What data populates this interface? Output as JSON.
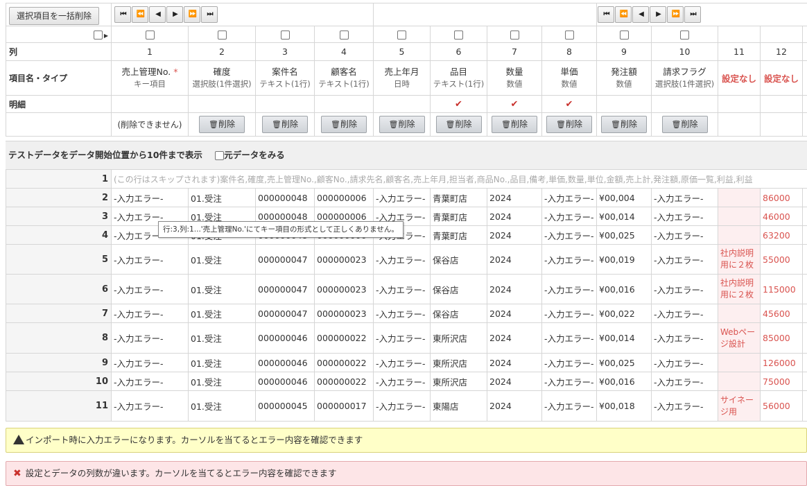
{
  "toolbar": {
    "bulk_delete_label": "選択項目を一括削除",
    "nav_first": "⏮",
    "nav_prev_fast": "⏪",
    "nav_prev": "◀",
    "nav_next": "▶",
    "nav_next_fast": "⏩",
    "nav_last": "⏭"
  },
  "header_rows": {
    "col_label": "列",
    "name_label": "項目名・タイプ",
    "detail_label": "明細",
    "undeletable": "(削除できません)",
    "delete_label": "削除"
  },
  "columns": [
    {
      "num": "1",
      "name": "売上管理No.",
      "required": "*",
      "type": "キー項目",
      "detail": "",
      "deletable": false
    },
    {
      "num": "2",
      "name": "確度",
      "type": "選択肢(1件選択)",
      "detail": "",
      "deletable": true
    },
    {
      "num": "3",
      "name": "案件名",
      "type": "テキスト(1行)",
      "detail": "",
      "deletable": true
    },
    {
      "num": "4",
      "name": "顧客名",
      "type": "テキスト(1行)",
      "detail": "",
      "deletable": true
    },
    {
      "num": "5",
      "name": "売上年月",
      "type": "日時",
      "detail": "",
      "deletable": true
    },
    {
      "num": "6",
      "name": "品目",
      "type": "テキスト(1行)",
      "detail": "✔",
      "deletable": true
    },
    {
      "num": "7",
      "name": "数量",
      "type": "数値",
      "detail": "✔",
      "deletable": true
    },
    {
      "num": "8",
      "name": "単価",
      "type": "数値",
      "detail": "✔",
      "deletable": true
    },
    {
      "num": "9",
      "name": "発注額",
      "type": "数値",
      "detail": "",
      "deletable": true
    },
    {
      "num": "10",
      "name": "請求フラグ",
      "type": "選択肢(1件選択)",
      "detail": "",
      "deletable": true
    },
    {
      "num": "11",
      "name": "設定なし"
    },
    {
      "num": "12",
      "name": "設定なし"
    }
  ],
  "test_bar": {
    "label": "テストデータをデータ開始位置から10件まで表示",
    "show_original": "元データをみる"
  },
  "skip_row": {
    "num": "1",
    "text": "(この行はスキップされます)案件名,確度,売上管理No.,顧客No.,請求先名,顧客名,売上年月,担当者,商品No.,品目,備考,単価,数量,単位,金額,売上計,発注額,原価一覧,利益,利益"
  },
  "rows": [
    {
      "num": "2",
      "c1": "-入力エラー-",
      "c2": "01.受注",
      "c3": "000000048",
      "c4": "000000006",
      "c5": "-入力エラー-",
      "c6": "青葉町店",
      "c7": "2024",
      "c8": "-入力エラー-",
      "c9": "¥00,004",
      "c10": "-入力エラー-",
      "c11": "",
      "c12": "86000"
    },
    {
      "num": "3",
      "c1": "-入力エラー-",
      "c2": "01.受注",
      "c3": "000000048",
      "c4": "000000006",
      "c5": "-入力エラー-",
      "c6": "青葉町店",
      "c7": "2024",
      "c8": "-入力エラー-",
      "c9": "¥00,014",
      "c10": "-入力エラー-",
      "c11": "",
      "c12": "46000"
    },
    {
      "num": "4",
      "c1": "-入力エラー-",
      "c2": "01.受注",
      "c3": "000000048",
      "c4": "000000006",
      "c5": "-入力エラー-",
      "c6": "青葉町店",
      "c7": "2024",
      "c8": "-入力エラー-",
      "c9": "¥00,025",
      "c10": "-入力エラー-",
      "c11": "",
      "c12": "63200"
    },
    {
      "num": "5",
      "c1": "-入力エラー-",
      "c2": "01.受注",
      "c3": "000000047",
      "c4": "000000023",
      "c5": "-入力エラー-",
      "c6": "保谷店",
      "c7": "2024",
      "c8": "-入力エラー-",
      "c9": "¥00,019",
      "c10": "-入力エラー-",
      "c11": "社内説明用に２枚",
      "c12": "55000"
    },
    {
      "num": "6",
      "c1": "-入力エラー-",
      "c2": "01.受注",
      "c3": "000000047",
      "c4": "000000023",
      "c5": "-入力エラー-",
      "c6": "保谷店",
      "c7": "2024",
      "c8": "-入力エラー-",
      "c9": "¥00,016",
      "c10": "-入力エラー-",
      "c11": "社内説明用に２枚",
      "c12": "115000"
    },
    {
      "num": "7",
      "c1": "-入力エラー-",
      "c2": "01.受注",
      "c3": "000000047",
      "c4": "000000023",
      "c5": "-入力エラー-",
      "c6": "保谷店",
      "c7": "2024",
      "c8": "-入力エラー-",
      "c9": "¥00,022",
      "c10": "-入力エラー-",
      "c11": "",
      "c12": "45600"
    },
    {
      "num": "8",
      "c1": "-入力エラー-",
      "c2": "01.受注",
      "c3": "000000046",
      "c4": "000000022",
      "c5": "-入力エラー-",
      "c6": "東所沢店",
      "c7": "2024",
      "c8": "-入力エラー-",
      "c9": "¥00,014",
      "c10": "-入力エラー-",
      "c11": "Webページ設計",
      "c12": "85000"
    },
    {
      "num": "9",
      "c1": "-入力エラー-",
      "c2": "01.受注",
      "c3": "000000046",
      "c4": "000000022",
      "c5": "-入力エラー-",
      "c6": "東所沢店",
      "c7": "2024",
      "c8": "-入力エラー-",
      "c9": "¥00,025",
      "c10": "-入力エラー-",
      "c11": "",
      "c12": "126000"
    },
    {
      "num": "10",
      "c1": "-入力エラー-",
      "c2": "01.受注",
      "c3": "000000046",
      "c4": "000000022",
      "c5": "-入力エラー-",
      "c6": "東所沢店",
      "c7": "2024",
      "c8": "-入力エラー-",
      "c9": "¥00,016",
      "c10": "-入力エラー-",
      "c11": "",
      "c12": "75000"
    },
    {
      "num": "11",
      "c1": "-入力エラー-",
      "c2": "01.受注",
      "c3": "000000045",
      "c4": "000000017",
      "c5": "-入力エラー-",
      "c6": "東陽店",
      "c7": "2024",
      "c8": "-入力エラー-",
      "c9": "¥00,018",
      "c10": "-入力エラー-",
      "c11": "サイネージ用",
      "c12": "56000"
    }
  ],
  "tooltip": "行:3,列:1...'売上管理No.'にてキー項目の形式として正しくありません。",
  "alerts": {
    "warning": "インポート時に入力エラーになります。カーソルを当てるとエラー内容を確認できます",
    "error": "設定とデータの列数が違います。カーソルを当てるとエラー内容を確認できます"
  }
}
